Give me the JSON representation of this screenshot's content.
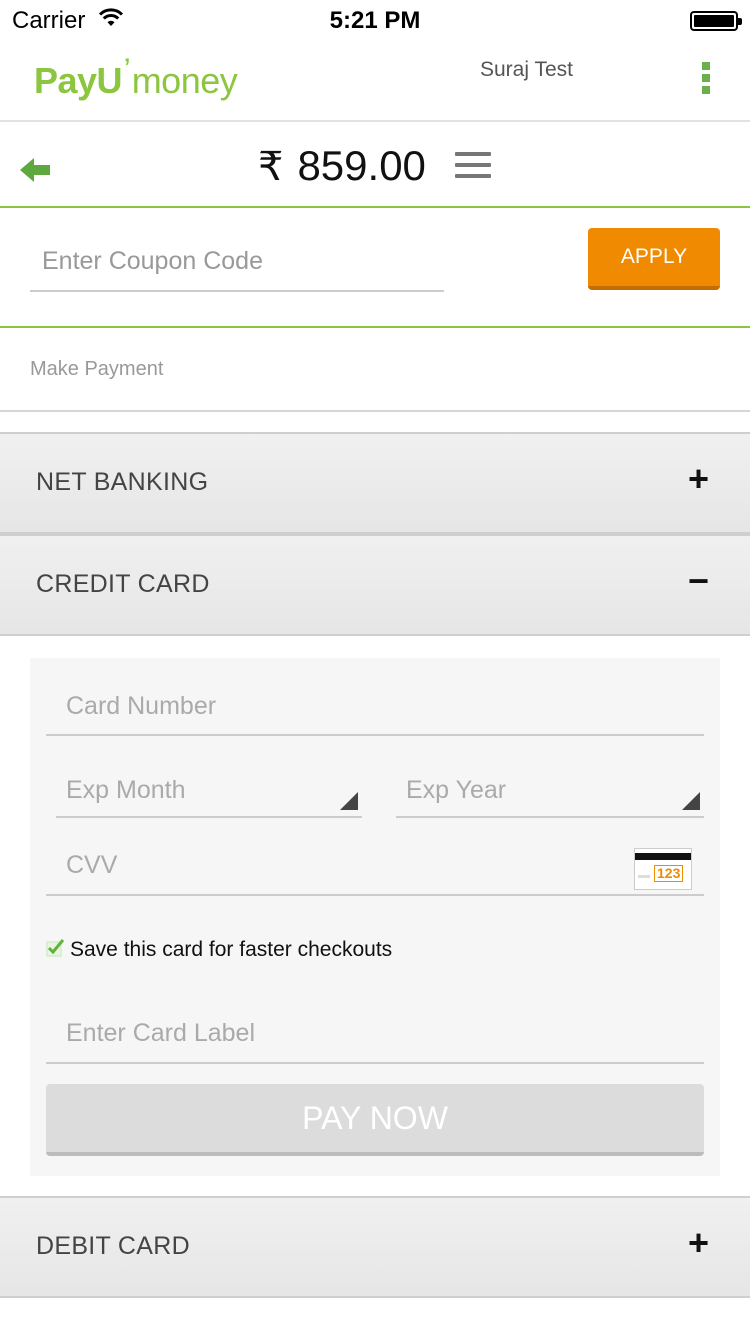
{
  "status_bar": {
    "carrier": "Carrier",
    "time": "5:21 PM"
  },
  "header": {
    "logo": {
      "part1": "PayU",
      "mark": "’",
      "part2": "money"
    },
    "user_name": "Suraj Test",
    "brand_color": "#8cc63f"
  },
  "amount_bar": {
    "currency_symbol": "₹",
    "amount": "859.00"
  },
  "coupon": {
    "placeholder": "Enter Coupon Code",
    "value": "",
    "apply_label": "APPLY",
    "apply_color": "#f08a00"
  },
  "make_payment_label": "Make Payment",
  "sections": [
    {
      "label": "NET BANKING",
      "toggle": "+",
      "expanded": false
    },
    {
      "label": "CREDIT CARD",
      "toggle": "−",
      "expanded": true
    },
    {
      "label": "DEBIT CARD",
      "toggle": "+",
      "expanded": false
    }
  ],
  "credit_card_form": {
    "card_number_placeholder": "Card Number",
    "exp_month_placeholder": "Exp Month",
    "exp_year_placeholder": "Exp Year",
    "cvv_placeholder": "CVV",
    "cvv_icon_text": "123",
    "save_card_checked": true,
    "save_card_label": "Save this card for faster checkouts",
    "card_label_placeholder": "Enter Card Label",
    "pay_now_label": "PAY NOW"
  }
}
